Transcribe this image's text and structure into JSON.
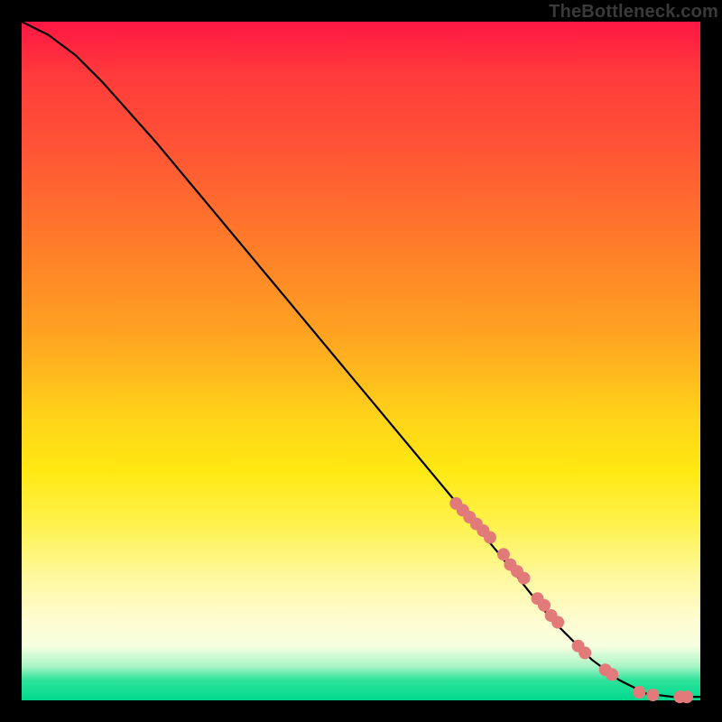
{
  "watermark": "TheBottleneck.com",
  "chart_data": {
    "type": "line",
    "title": "",
    "xlabel": "",
    "ylabel": "",
    "xlim": [
      0,
      100
    ],
    "ylim": [
      0,
      100
    ],
    "grid": false,
    "series": [
      {
        "name": "bottleneck-curve",
        "x": [
          0,
          4,
          8,
          12,
          20,
          30,
          40,
          50,
          60,
          70,
          78,
          84,
          88,
          92,
          96,
          100
        ],
        "y": [
          100,
          98,
          95,
          91,
          82,
          70,
          58,
          46,
          34,
          22,
          12,
          6,
          3,
          1,
          0.5,
          0.5
        ]
      }
    ],
    "highlight_points": {
      "name": "highlighted-range-dots",
      "color": "#e27a7a",
      "points": [
        {
          "x": 64,
          "y": 29
        },
        {
          "x": 65,
          "y": 28
        },
        {
          "x": 66,
          "y": 27
        },
        {
          "x": 67,
          "y": 26
        },
        {
          "x": 68,
          "y": 25
        },
        {
          "x": 69,
          "y": 24
        },
        {
          "x": 71,
          "y": 21.5
        },
        {
          "x": 72,
          "y": 20
        },
        {
          "x": 73,
          "y": 19
        },
        {
          "x": 74,
          "y": 18
        },
        {
          "x": 76,
          "y": 15
        },
        {
          "x": 77,
          "y": 14
        },
        {
          "x": 78,
          "y": 12.5
        },
        {
          "x": 79,
          "y": 11.5
        },
        {
          "x": 82,
          "y": 8
        },
        {
          "x": 83,
          "y": 7
        },
        {
          "x": 86,
          "y": 4.5
        },
        {
          "x": 87,
          "y": 3.8
        },
        {
          "x": 91,
          "y": 1.2
        },
        {
          "x": 93,
          "y": 0.8
        },
        {
          "x": 97,
          "y": 0.5
        },
        {
          "x": 98,
          "y": 0.5
        }
      ]
    }
  }
}
